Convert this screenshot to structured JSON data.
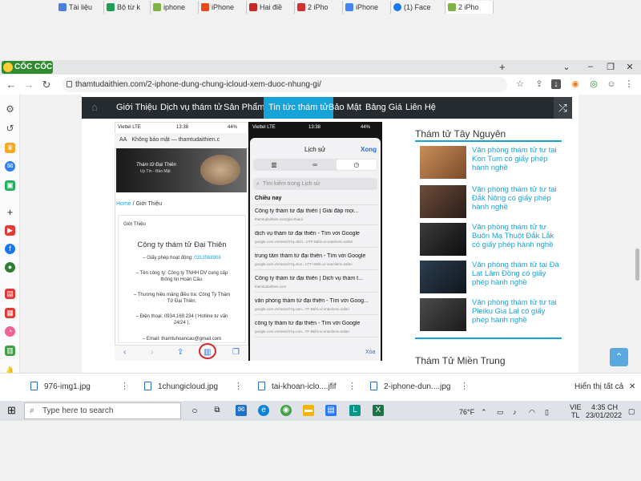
{
  "browser": {
    "brand": "CỐC CỐC",
    "tabs": [
      "Tài liệu",
      "Bộ từ k",
      "iphone",
      "iPhone",
      "Hai điề",
      "2 iPho",
      "iPhone",
      "(1) Face",
      "2 iPho"
    ],
    "new_tab": "+",
    "url": "thamtudaithien.com/2-iphone-dung-chung-icloud-xem-duoc-nhung-gi/"
  },
  "site": {
    "nav": [
      "Giới Thiệu",
      "Dịch vụ thám tử",
      "Sản Phẩm",
      "Tin tức thám tử",
      "Bảo Mật",
      "Bảng Giá",
      "Liên Hệ"
    ],
    "active_nav": "Tin tức thám tử"
  },
  "phone1": {
    "carrier": "Viettel LTE",
    "time": "13:38",
    "battery": "44%",
    "address": "Không bảo mật — thamtudaithien.c",
    "aa": "AA",
    "banner_title": "Thám tử Đại Thiên",
    "banner_sub": "Uy Tín - Bảo Mật",
    "crumb_home": "Home",
    "crumb_sep": "/",
    "crumb_page": "Giới Thiệu",
    "box_label": "Giới Thiệu",
    "company": "Công ty thám tử Đại Thiên",
    "license_label": "– Giấy phép hoạt động:",
    "license_no": "0313568908",
    "line_company1": "– Tên công ty: Công ty TNHH DV cung cấp",
    "line_company2": "thông tin Hoàn Cầu.",
    "line_brand1": "– Thương hiệu mảng điều tra: Công Ty Thám",
    "line_brand2": "Tử Đại Thiên.",
    "line_phone1": "– Điện thoại: 0934.169.234 ( Hotline tư vấn",
    "line_phone2": "24/24 ).",
    "line_email": "– Email: thamtuhoancau@gmail.com"
  },
  "phone2": {
    "carrier": "Viettel LTE",
    "time": "13:38",
    "battery": "44%",
    "title": "Lịch sử",
    "done": "Xong",
    "search_placeholder": "Tìm kiếm trong Lịch sử",
    "section": "Chiều nay",
    "clear": "Xóa",
    "items": [
      {
        "title": "Công ty thám tử đại thiên | Giải đáp mọi...",
        "url": "thamtudaithien.com/gioi-thieu/"
      },
      {
        "title": "dịch vụ thám tử đại thiên - Tìm với Google",
        "url": "google.com.vn/search?q=dich...UTF-8&hl=vi-vn&client=safari"
      },
      {
        "title": "trung tâm thám tử đại thiên - Tìm với Google",
        "url": "google.com.vn/search?q=trun...UTF-8&hl=vi-vn&client=safari"
      },
      {
        "title": "Công ty thám tử đại thiên | Dịch vụ thám t...",
        "url": "thamtudaithien.com"
      },
      {
        "title": "văn phòng thám tử đại thiên - Tìm với Goog...",
        "url": "google.com.vn/search?q=van...TF-8&hl=vi-vn&client=safari"
      },
      {
        "title": "công ty thám tử đại thiên - Tìm với Google",
        "url": "google.com.vn/search?q=con...TF-8&hl=vi-vn&client=safari"
      }
    ]
  },
  "sidebar_right": {
    "heading1": "Thám tử Tây Nguyên",
    "links": [
      "Văn phòng thám tử tư tại Kon Tum có giấy phép hành nghề",
      "Văn phòng thám tử tư tại Đắk Nông có giấy phép hành nghề",
      "Văn phòng thám tử tư Buôn Mạ Thuột Đắk Lắk có giấy phép hành nghề",
      "Văn phòng thám tử tại Đà Lạt Lâm Đồng có giấy phép hành nghề",
      "Văn phòng thám tử tư tại Pleiku Gia Lai có giấy phép hành nghề"
    ],
    "heading2": "Thám Tử Miền Trung"
  },
  "downloads": {
    "files": [
      "976-img1.jpg",
      "1chungicloud.jpg",
      "tai-khoan-iclo....jfif",
      "2-iphone-dun....jpg"
    ],
    "show_all": "Hiển thị tất cả",
    "close": "✕"
  },
  "taskbar": {
    "search_placeholder": "Type here to search",
    "weather": "76°F",
    "lang1": "VIE",
    "lang2": "TL",
    "time": "4:35 CH",
    "date": "23/01/2022"
  },
  "colors": {
    "accent": "#18a3d8",
    "nav_bg": "#262b30",
    "brand_green": "#2e8b2e"
  }
}
